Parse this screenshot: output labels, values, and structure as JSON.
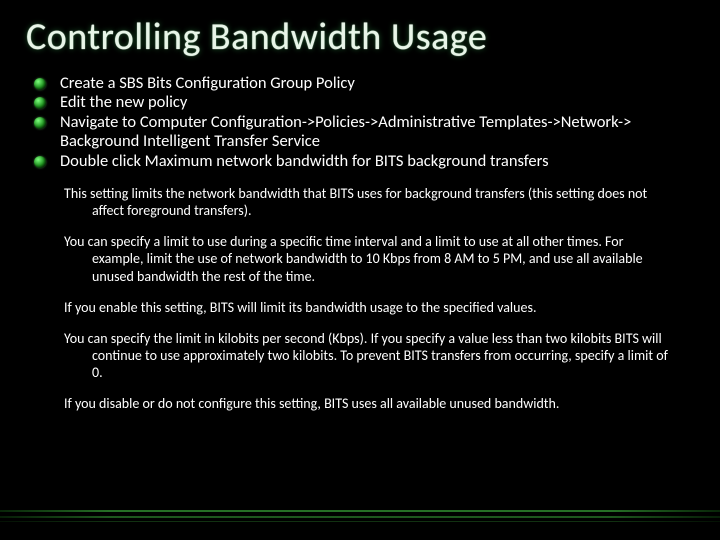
{
  "title": "Controlling Bandwidth Usage",
  "bullets": [
    "Create a SBS Bits Configuration Group Policy",
    "Edit the new policy",
    "Navigate to Computer Configuration->Policies->Administrative Templates->Network-> Background Intelligent Transfer Service",
    "Double click Maximum network bandwidth for BITS background transfers"
  ],
  "paragraphs": [
    "This setting limits the network bandwidth that BITS uses for background transfers (this setting does not affect foreground transfers).",
    "You can specify a limit to use during a specific time interval and a limit to use at all other times. For example, limit the use of network bandwidth to 10 Kbps from 8 AM to 5 PM, and use all available unused bandwidth the rest of the time.",
    "If you enable this setting, BITS will limit its bandwidth usage to the specified values.",
    "You can specify the limit in kilobits per second (Kbps). If you specify a value less than two kilobits BITS will continue to use approximately two kilobits. To prevent BITS transfers from occurring, specify a limit of 0.",
    "If you disable or do not configure this setting, BITS uses all available unused bandwidth."
  ]
}
